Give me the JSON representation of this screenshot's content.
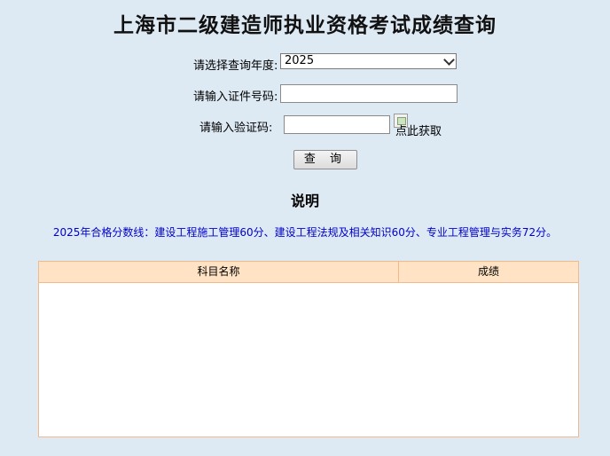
{
  "title": "上海市二级建造师执业资格考试成绩查询",
  "form": {
    "year_label": "请选择查询年度:",
    "year_value": "2025",
    "id_label": "请输入证件号码:",
    "id_value": "",
    "captcha_label": "请输入验证码:",
    "captcha_value": "",
    "captcha_link": "点此获取",
    "submit_label": "查 询"
  },
  "explain": {
    "heading": "说明",
    "notice": "2025年合格分数线：建设工程施工管理60分、建设工程法规及相关知识60分、专业工程管理与实务72分。"
  },
  "table": {
    "headers": [
      "科目名称",
      "成绩"
    ],
    "rows": []
  }
}
